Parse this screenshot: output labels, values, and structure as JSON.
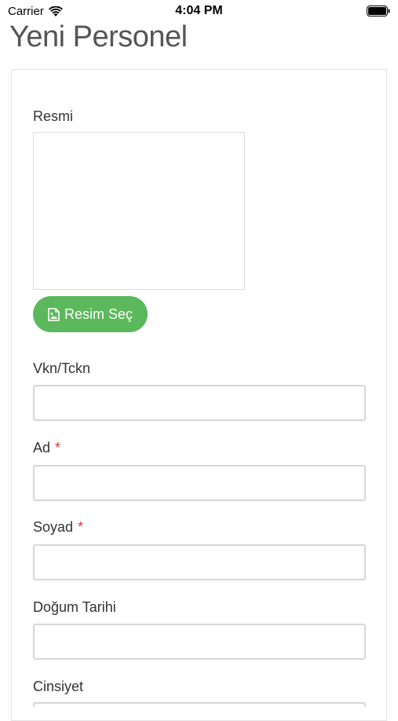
{
  "status_bar": {
    "carrier": "Carrier",
    "time": "4:04 PM"
  },
  "page": {
    "title": "Yeni Personel"
  },
  "form": {
    "photo_label": "Resmi",
    "select_image_label": "Resim Seç",
    "vkn_label": "Vkn/Tckn",
    "vkn_value": "",
    "name_label": "Ad",
    "name_required": "*",
    "name_value": "",
    "surname_label": "Soyad",
    "surname_required": "*",
    "surname_value": "",
    "birthdate_label": "Doğum Tarihi",
    "birthdate_value": "",
    "gender_label": "Cinsiyet"
  },
  "colors": {
    "accent_green": "#5cb85c",
    "required_red": "#d9373a"
  },
  "icons": {
    "wifi": "wifi-icon",
    "battery": "battery-icon",
    "image": "image-icon"
  }
}
